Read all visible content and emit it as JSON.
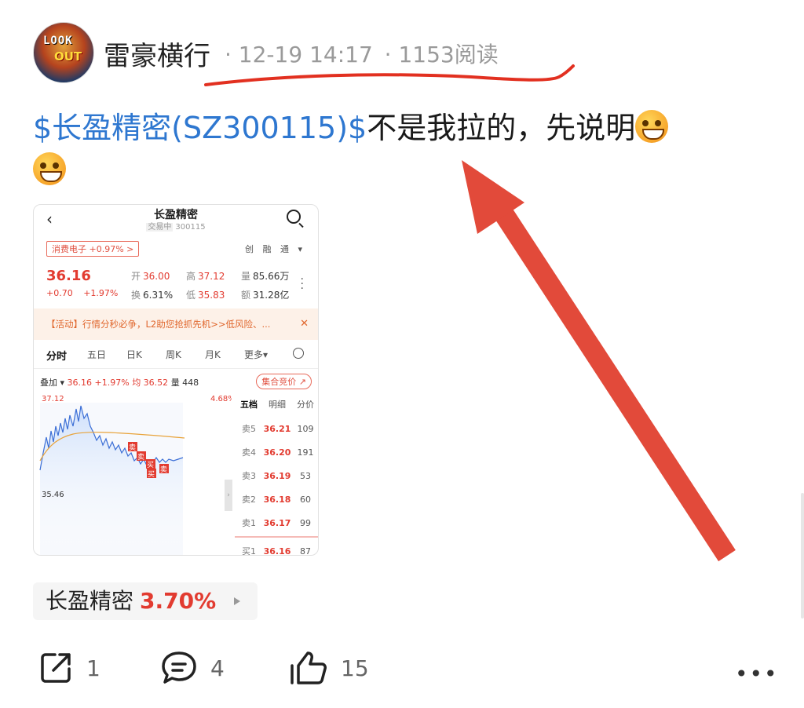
{
  "header": {
    "avatar_text_1": "LOOK",
    "avatar_text_2": "OUT",
    "author": "雷豪横行",
    "meta_time": "· 12-19 14:17",
    "meta_reads": "· 1153阅读"
  },
  "post": {
    "stock_link": "$长盈精密(SZ300115)$",
    "text": "不是我拉的，先说明"
  },
  "screenshot": {
    "back_icon": "chevron-left-icon",
    "title": "长盈精密",
    "subtitle_tag": "交易中",
    "subtitle_code": "300115",
    "sector": "消费电子 +0.97% >",
    "badges": [
      "创",
      "融",
      "通",
      "▾"
    ],
    "price": "36.16",
    "change_abs": "+0.70",
    "change_pct": "+1.97%",
    "quote": [
      [
        {
          "label": "开",
          "value": "36.00",
          "tone": "red"
        },
        {
          "label": "高",
          "value": "37.12",
          "tone": "red"
        },
        {
          "label": "量",
          "value": "85.66万",
          "tone": "plain"
        }
      ],
      [
        {
          "label": "换",
          "value": "6.31%",
          "tone": "plain"
        },
        {
          "label": "低",
          "value": "35.83",
          "tone": "grn"
        },
        {
          "label": "额",
          "value": "31.28亿",
          "tone": "plain"
        }
      ]
    ],
    "promo": "【活动】行情分秒必争，L2助您抢抓先机>>低风险、...",
    "promo_close": "✕",
    "tabs": [
      "分时",
      "五日",
      "日K",
      "周K",
      "月K",
      "更多▾"
    ],
    "overlay": "叠加 ▾",
    "overlay_price": "36.16 +1.97%",
    "overlay_avg": "均 36.52",
    "overlay_vol": "量 448",
    "auction_button": "集合竞价 ↗",
    "chart_high_label": "37.12",
    "chart_low_label": "35.46",
    "chart_pct_label": "4.68%",
    "trade_markers": [
      "卖",
      "卖",
      "买",
      "买",
      "卖"
    ],
    "book_tabs": [
      "五档",
      "明细",
      "分价"
    ],
    "book": [
      {
        "side": "卖5",
        "price": "36.21",
        "vol": "109"
      },
      {
        "side": "卖4",
        "price": "36.20",
        "vol": "191"
      },
      {
        "side": "卖3",
        "price": "36.19",
        "vol": "53"
      },
      {
        "side": "卖2",
        "price": "36.18",
        "vol": "60"
      },
      {
        "side": "卖1",
        "price": "36.17",
        "vol": "99"
      },
      {
        "side": "买1",
        "price": "36.16",
        "vol": "87"
      }
    ]
  },
  "chip": {
    "name": "长盈精密",
    "change": "3.70%"
  },
  "actions": {
    "share_count": "1",
    "comment_count": "4",
    "like_count": "15",
    "more_label": "•••"
  }
}
